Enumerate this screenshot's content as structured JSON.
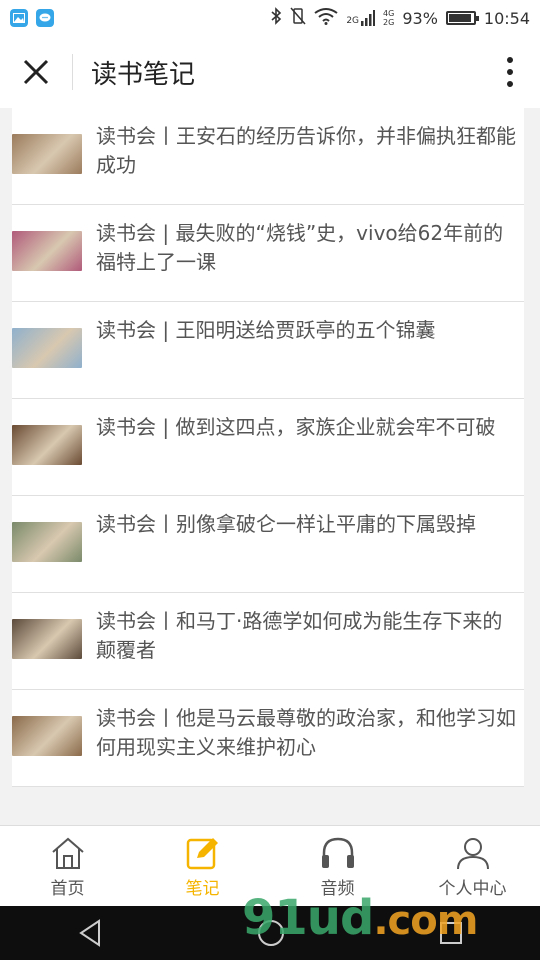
{
  "status_bar": {
    "network_2g": "2G",
    "network_4g": "4G",
    "battery": "93%",
    "battery_level": 0.93,
    "time": "10:54"
  },
  "header": {
    "title": "读书笔记"
  },
  "articles": [
    {
      "title": "读书会丨王安石的经历告诉你，并非偏执狂都能成功",
      "thumb_color": "#9b7b5c"
    },
    {
      "title": "读书会 | 最失败的“烧钱”史，vivo给62年前的福特上了一课",
      "thumb_color": "#b05a7a"
    },
    {
      "title": "读书会 | 王阳明送给贾跃亭的五个锦囊",
      "thumb_color": "#8fb0cc"
    },
    {
      "title": "读书会 | 做到这四点，家族企业就会牢不可破",
      "thumb_color": "#6a4a32"
    },
    {
      "title": "读书会丨别像拿破仑一样让平庸的下属毁掉",
      "thumb_color": "#7a8a6a"
    },
    {
      "title": "读书会丨和马丁·路德学如何成为能生存下来的颠覆者",
      "thumb_color": "#5c4a3a"
    },
    {
      "title": "读书会丨他是马云最尊敬的政治家，和他学习如何用现实主义来维护初心",
      "thumb_color": "#8a6a4a"
    }
  ],
  "tabs": [
    {
      "label": "首页",
      "icon": "home-icon"
    },
    {
      "label": "笔记",
      "icon": "note-icon",
      "active": true
    },
    {
      "label": "音频",
      "icon": "headphones-icon"
    },
    {
      "label": "个人中心",
      "icon": "user-icon"
    }
  ],
  "watermark": {
    "main": "91ud",
    "suffix": ".com"
  },
  "colors": {
    "accent": "#f5b400",
    "background": "#f2f2f2"
  }
}
